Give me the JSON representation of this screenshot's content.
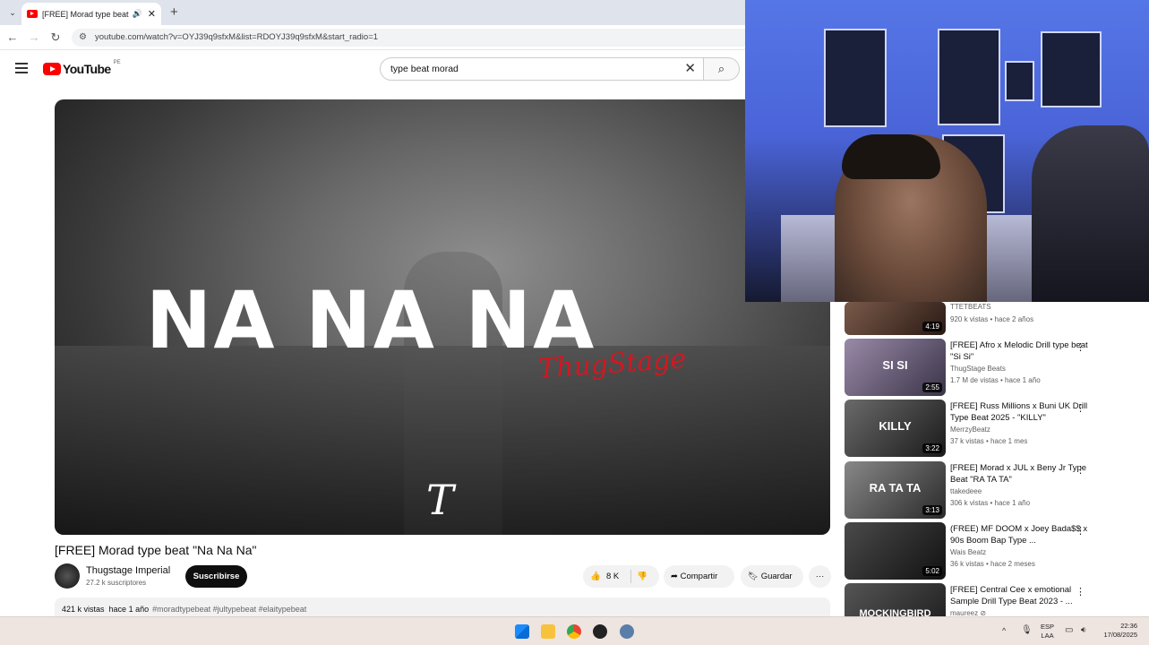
{
  "browser": {
    "tab_title": "[FREE] Morad type beat \"Na Na",
    "tab_close": "✕",
    "new_tab": "+",
    "tab_menu": "⌄",
    "url": "youtube.com/watch?v=OYJ39q9sfxM&list=RDOYJ39q9sfxM&start_radio=1",
    "nav": {
      "back": "←",
      "forward": "→",
      "reload": "↻"
    }
  },
  "youtube": {
    "logo_text": "YouTube",
    "region": "PE",
    "search_value": "type beat morad",
    "search_clear": "✕",
    "search_icon": "⌕"
  },
  "video": {
    "overlay_text": "NA NA NA",
    "overlay_signature": "ThugStage",
    "watermark": "T",
    "title": "[FREE] Morad type beat \"Na Na Na\"",
    "channel": "Thugstage Imperial",
    "subscribers": "27.2 k suscriptores",
    "subscribe_label": "Suscribirse",
    "like_icon": "👍",
    "likes": "8 K",
    "dislike_icon": "👎",
    "share_label": "Compartir",
    "save_label": "Guardar",
    "more_icon": "···",
    "views": "421 k vistas",
    "age": "hace 1 año",
    "tags": "#moradtypebeat #jultypebeat #elaitypebeat"
  },
  "recommendations": [
    {
      "thumb_text": "",
      "duration": "4:19",
      "title": "",
      "channel": "TTETBEATS",
      "meta": "920 k vistas • hace 2 años"
    },
    {
      "thumb_text": "SI SI",
      "duration": "2:55",
      "title": "[FREE] Afro x Melodic Drill type beat \"Si Si\"",
      "channel": "ThugStage Beats",
      "meta": "1.7 M de vistas • hace 1 año"
    },
    {
      "thumb_text": "KILLY",
      "duration": "3:22",
      "title": "[FREE] Russ Millions x Buni UK Drill Type Beat 2025 - \"KILLY\"",
      "channel": "MerrzyBeatz",
      "meta": "37 k vistas • hace 1 mes"
    },
    {
      "thumb_text": "RA TA TA",
      "duration": "3:13",
      "title": "[FREE] Morad x JUL x Beny Jr Type Beat \"RA TA TA\"",
      "channel": "ttakedeee",
      "meta": "306 k vistas • hace 1 año"
    },
    {
      "thumb_text": "",
      "duration": "5:02",
      "title": "(FREE) MF DOOM x Joey Bada$$ x 90s Boom Bap Type ...",
      "channel": "Wais Beatz",
      "meta": "36 k vistas • hace 2 meses"
    },
    {
      "thumb_text": "MOCKINGBIRD",
      "duration": "",
      "title": "[FREE] Central Cee x emotional Sample Drill Type Beat 2023 - ...",
      "channel": "maureez ⊘",
      "meta": ""
    }
  ],
  "taskbar": {
    "language": "ESP",
    "layout": "LAA",
    "time": "22:36",
    "date": "17/08/2025",
    "tray_up": "^"
  },
  "colors": {
    "youtube_red": "#ff0000",
    "signature_red": "#d01822",
    "cam_blue": "#4a64d8"
  }
}
